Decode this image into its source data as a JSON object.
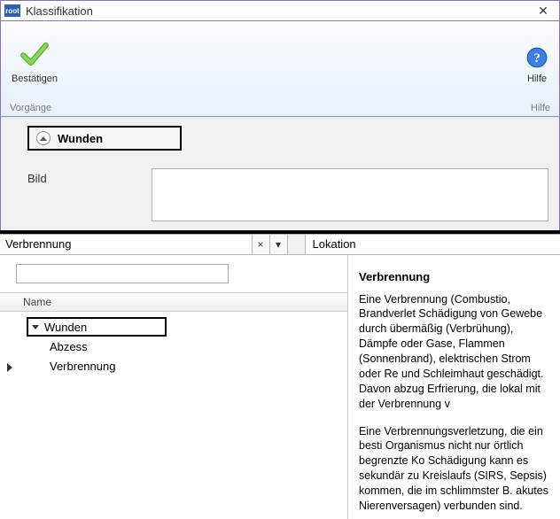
{
  "window": {
    "title": "Klassifikation",
    "app_icon_text": "root"
  },
  "toolbar": {
    "confirm_label": "Bestätigen",
    "help_label": "Hilfe"
  },
  "footer": {
    "left": "Vorgänge",
    "right": "Hilfe"
  },
  "upper": {
    "group_title": "Wunden",
    "bild_label": "Bild"
  },
  "search": {
    "term": "Verbrennung",
    "clear_glyph": "×",
    "dropdown_glyph": "▾",
    "lokation_label": "Lokation"
  },
  "tree": {
    "column_header": "Name",
    "parent": "Wunden",
    "children": [
      "Abzess",
      "Verbrennung"
    ]
  },
  "detail": {
    "title": "Verbrennung",
    "p1": "Eine Verbrennung (Combustio, Brandverlet Schädigung von Gewebe durch übermäßig (Verbrühung), Dämpfe oder Gase, Flammen (Sonnenbrand), elektrischen Strom oder Re und Schleimhaut geschädigt. Davon abzug Erfrierung, die lokal mit der Verbrennung v",
    "p2": "Eine Verbrennungsverletzung, die ein besti Organismus nicht nur örtlich begrenzte Ko Schädigung kann es sekundär zu Kreislaufs (SIRS, Sepsis) kommen, die im schlimmster B. akutes Nierenversagen) verbunden sind."
  }
}
